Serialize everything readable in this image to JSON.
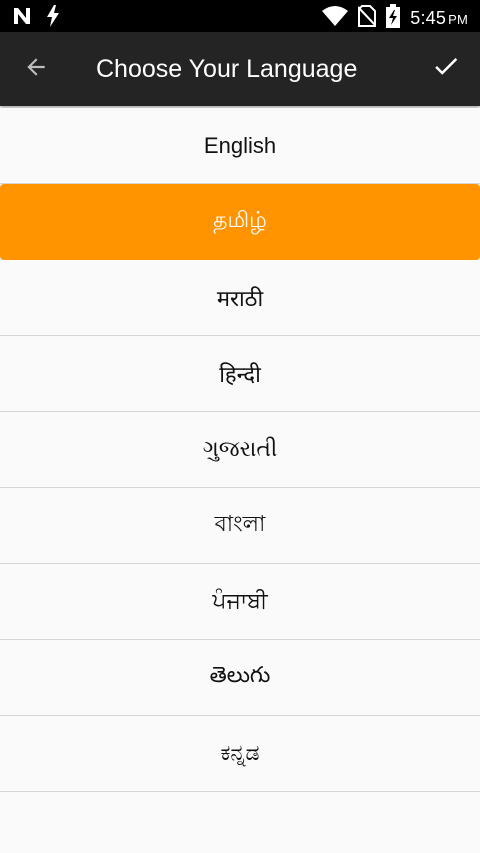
{
  "status_bar": {
    "time": "5:45",
    "ampm": "PM",
    "icons": [
      "n-notification-icon",
      "flash-icon",
      "wifi-icon",
      "no-sim-icon",
      "battery-charging-icon"
    ]
  },
  "app_bar": {
    "title": "Choose Your Language",
    "back_icon": "arrow-left-icon",
    "confirm_icon": "check-icon"
  },
  "languages": [
    {
      "label": "English",
      "selected": false
    },
    {
      "label": "தமிழ்",
      "selected": true
    },
    {
      "label": "मराठी",
      "selected": false
    },
    {
      "label": "हिन्दी",
      "selected": false
    },
    {
      "label": "ગુજરાતી",
      "selected": false
    },
    {
      "label": "বাংলা",
      "selected": false
    },
    {
      "label": "ਪੰਜਾਬੀ",
      "selected": false
    },
    {
      "label": "తెలుగు",
      "selected": false
    },
    {
      "label": "ಕನ್ನಡ",
      "selected": false
    }
  ],
  "colors": {
    "status_bar": "#000000",
    "app_bar": "#242424",
    "selected_bg": "#ff9300",
    "list_bg": "#fafafa",
    "divider": "#d6d6d6"
  }
}
